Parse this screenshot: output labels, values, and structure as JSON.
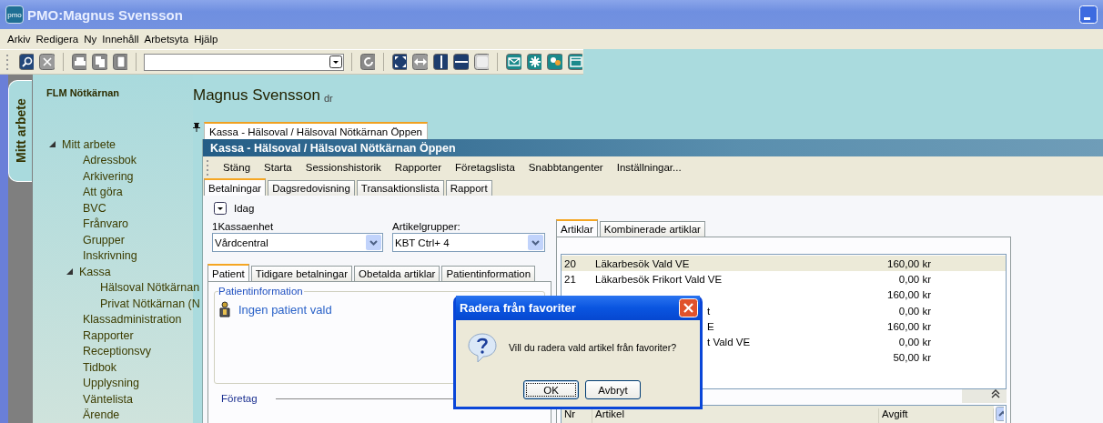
{
  "window": {
    "app_icon": "pmo",
    "title": "PMO:Magnus Svensson"
  },
  "menu": [
    "Arkiv",
    "Redigera",
    "Ny",
    "Innehåll",
    "Arbetsyta",
    "Hjälp"
  ],
  "side_tabs": [
    {
      "label": "Mitt arbete",
      "selected": true
    }
  ],
  "sidebar": {
    "title": "FLM Nötkärnan",
    "tree": [
      {
        "label": "Mitt arbete",
        "expanded": true,
        "children": [
          {
            "label": "Adressbok"
          },
          {
            "label": "Arkivering"
          },
          {
            "label": "Att göra"
          },
          {
            "label": "BVC"
          },
          {
            "label": "Frånvaro"
          },
          {
            "label": "Grupper"
          },
          {
            "label": "Inskrivning"
          },
          {
            "label": "Kassa",
            "expanded": true,
            "children": [
              {
                "label": "Hälsoval Nötkärnan"
              },
              {
                "label": "Privat Nötkärnan (N"
              }
            ]
          },
          {
            "label": "Klassadministration"
          },
          {
            "label": "Rapporter"
          },
          {
            "label": "Receptionsvy"
          },
          {
            "label": "Tidbok"
          },
          {
            "label": "Upplysning"
          },
          {
            "label": "Väntelista"
          },
          {
            "label": "Ärende"
          }
        ]
      }
    ]
  },
  "header": {
    "name": "Magnus Svensson",
    "suffix": "dr"
  },
  "doc_tabs": [
    {
      "label": "Kassa - Hälsoval / Hälsoval Nötkärnan Öppen",
      "selected": true
    }
  ],
  "inner": {
    "title": "Kassa - Hälsoval / Hälsoval Nötkärnan Öppen",
    "toolbar": [
      "Stäng",
      "Starta",
      "Sessionshistorik",
      "Rapporter",
      "Företagslista",
      "Snabbtangenter",
      "Inställningar..."
    ],
    "tabs": [
      {
        "label": "Betalningar",
        "selected": true
      },
      {
        "label": "Dagsredovisning",
        "selected": false
      },
      {
        "label": "Transaktionslista",
        "selected": false
      },
      {
        "label": "Rapport",
        "selected": false
      }
    ],
    "date_toggle": "Idag",
    "fields": [
      {
        "label": "1Kassaenhet",
        "value": "Vårdcentral"
      },
      {
        "label": "Artikelgrupper:",
        "value": "KBT Ctrl+ 4"
      }
    ],
    "patient_tabs": [
      {
        "label": "Patient",
        "selected": true
      },
      {
        "label": "Tidigare betalningar",
        "selected": false
      },
      {
        "label": "Obetalda artiklar",
        "selected": false
      },
      {
        "label": "Patientinformation",
        "selected": false
      }
    ],
    "patient_group": {
      "title": "Patientinformation",
      "link": "Ingen patient vald"
    },
    "company_group": {
      "title": "Företag"
    },
    "article_tabs": [
      {
        "label": "Artiklar",
        "selected": true
      },
      {
        "label": "Kombinerade artiklar",
        "selected": false
      }
    ],
    "articles": [
      {
        "kind": "full",
        "nr": "20",
        "name": "Läkarbesök Vald VE",
        "price": "160,00 kr",
        "selected": true
      },
      {
        "kind": "full",
        "nr": "21",
        "name": "Läkarbesök Frikort Vald VE",
        "price": "0,00 kr",
        "selected": false
      },
      {
        "kind": "covered",
        "price": "160,00 kr",
        "selected": false
      },
      {
        "kind": "covered",
        "name": "t",
        "price": "0,00 kr",
        "selected": false
      },
      {
        "kind": "covered",
        "name": "E",
        "price": "160,00 kr",
        "selected": false
      },
      {
        "kind": "covered",
        "name": "t Vald VE",
        "price": "0,00 kr",
        "selected": false
      },
      {
        "kind": "covered",
        "price": "50,00 kr",
        "selected": false
      }
    ],
    "bottom_columns": [
      "Nr",
      "Artikel",
      "Avgift"
    ]
  },
  "dialog": {
    "title": "Radera från favoriter",
    "message": "Vill du radera vald artikel från favoriter?",
    "buttons": [
      {
        "label": "OK",
        "default": true
      },
      {
        "label": "Avbryt",
        "default": false
      }
    ]
  }
}
